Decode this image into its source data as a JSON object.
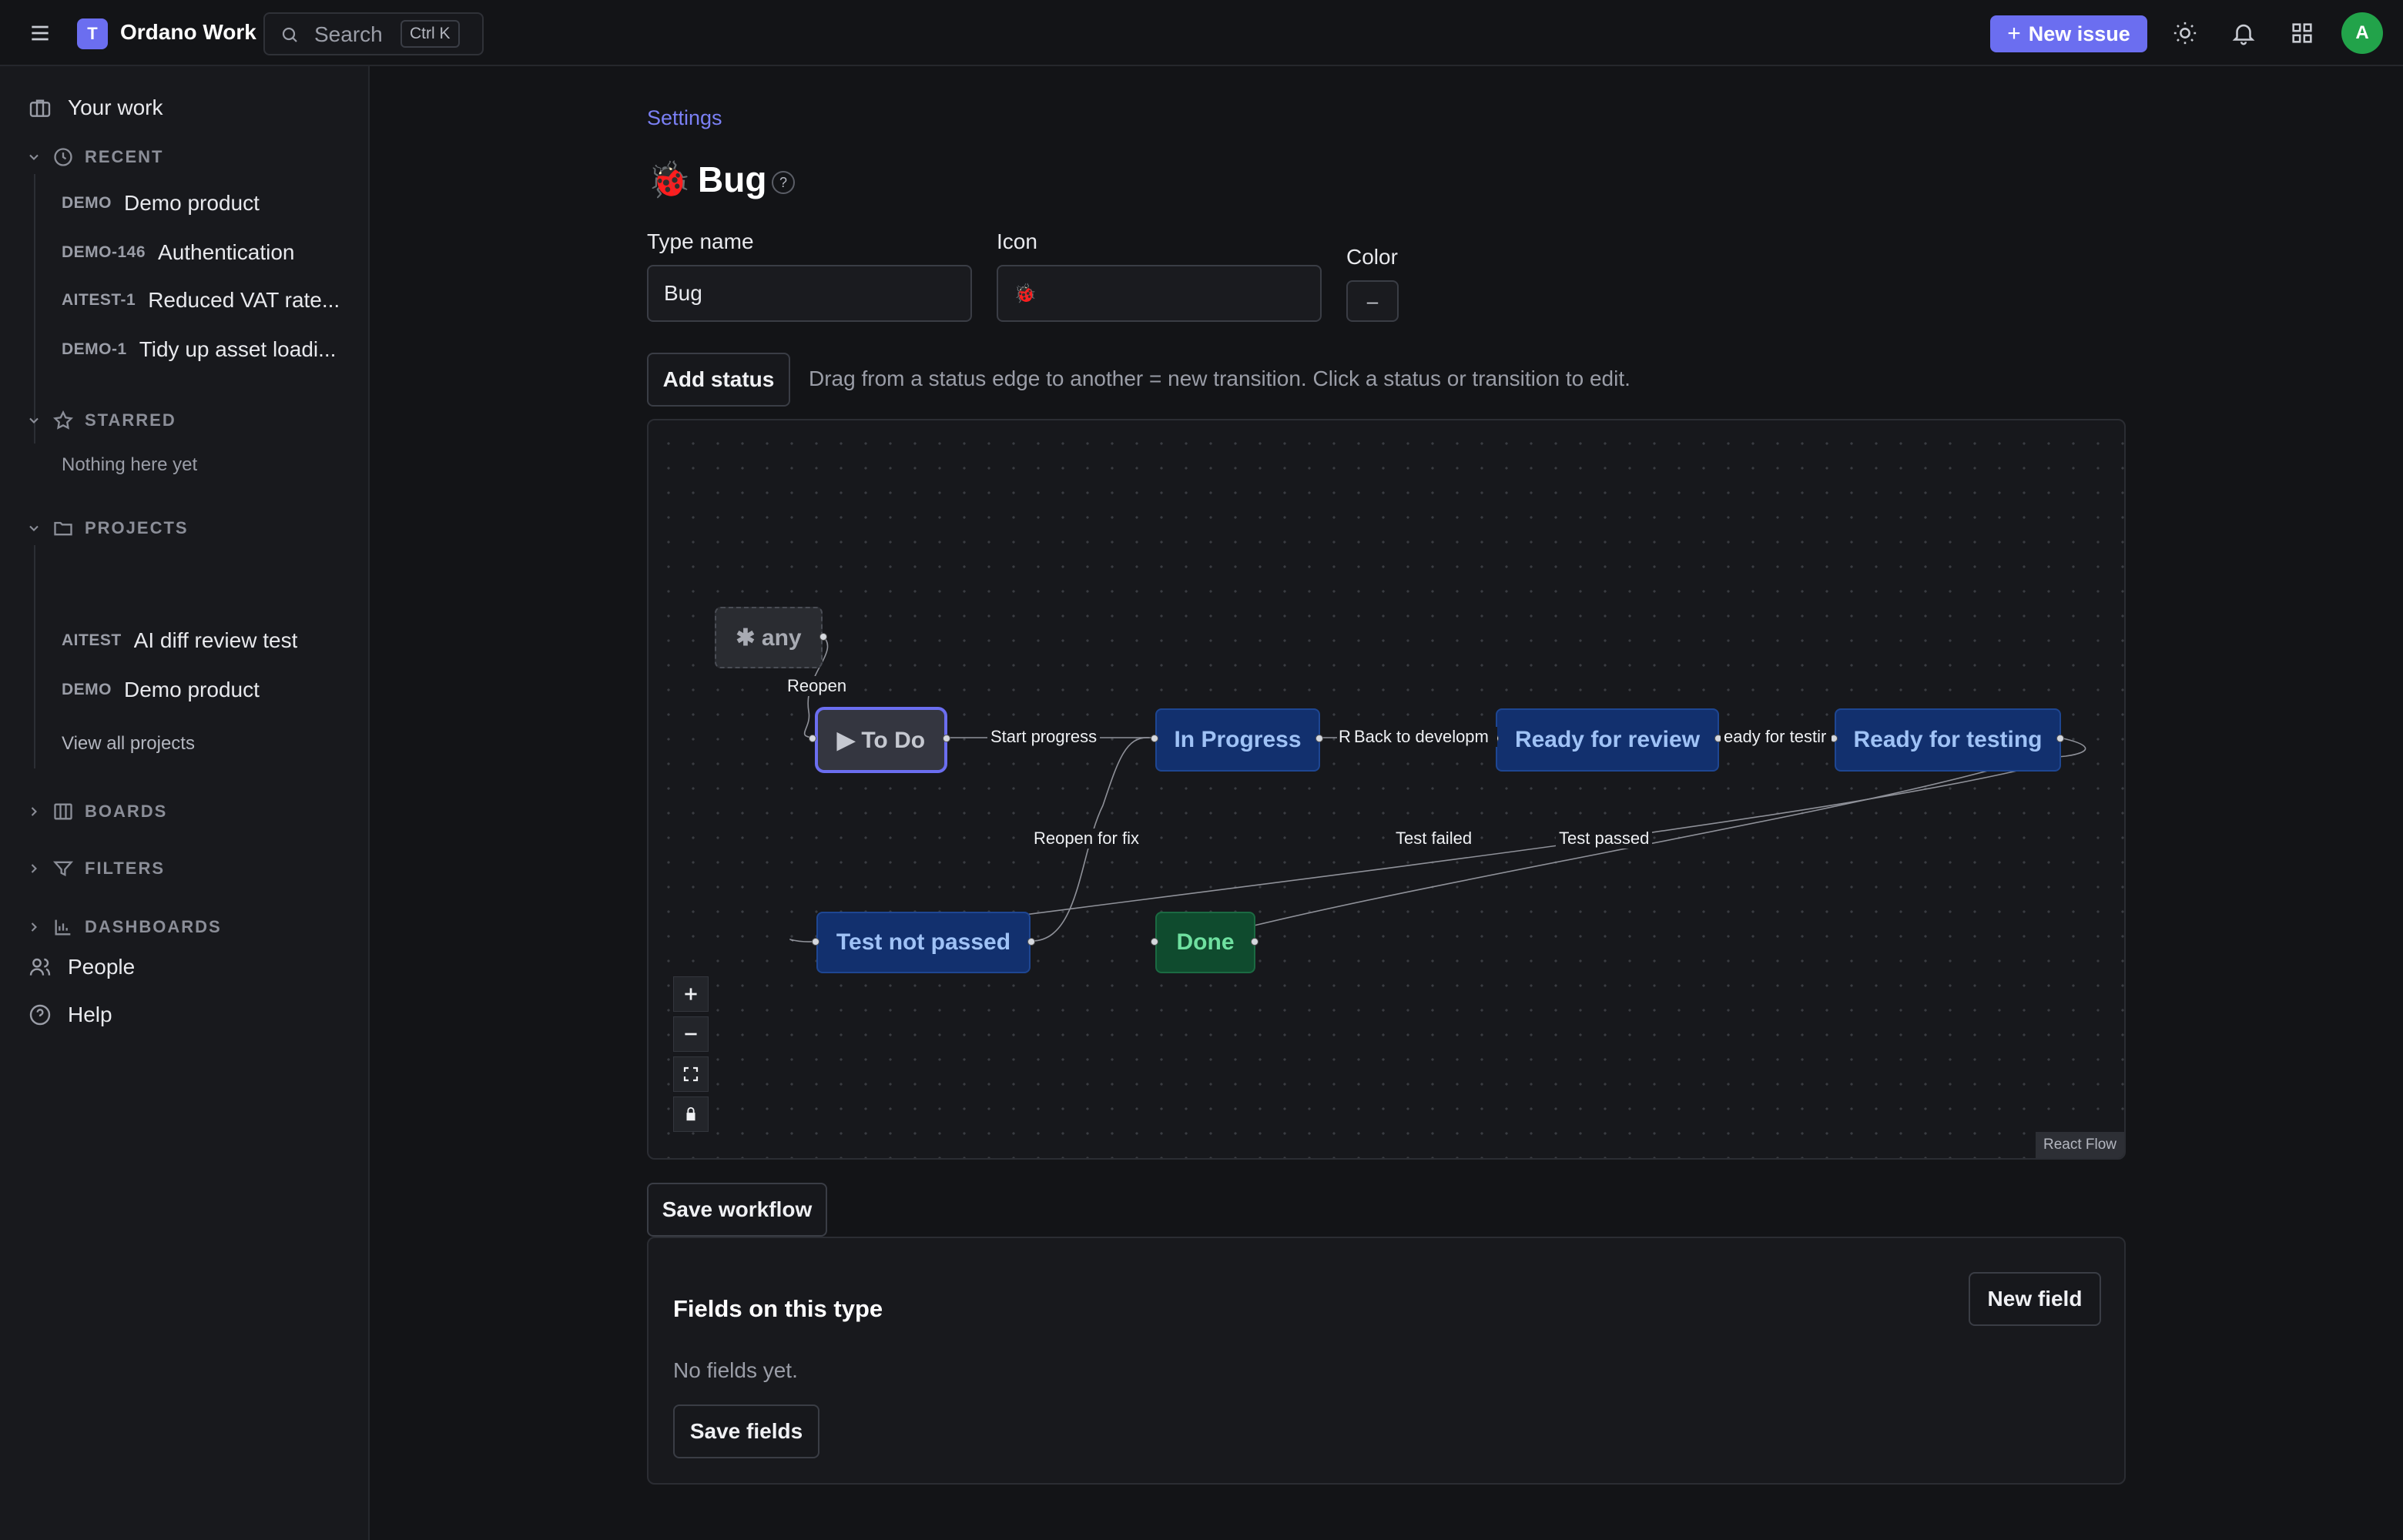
{
  "topbar": {
    "app_name": "Ordano Work",
    "logo_letter": "T",
    "search_placeholder": "Search",
    "search_shortcut": "Ctrl K",
    "new_issue_label": "New issue",
    "avatar_letter": "A",
    "accent_color": "#6b6ef0"
  },
  "sidebar": {
    "your_work": "Your work",
    "recent_heading": "RECENT",
    "recent_items": [
      {
        "key": "DEMO",
        "label": "Demo product"
      },
      {
        "key": "DEMO-146",
        "label": "Authentication"
      },
      {
        "key": "AITEST-1",
        "label": "Reduced VAT rate..."
      },
      {
        "key": "DEMO-1",
        "label": "Tidy up asset loadi..."
      }
    ],
    "starred_heading": "STARRED",
    "starred_empty": "Nothing here yet",
    "projects_heading": "PROJECTS",
    "projects": [
      {
        "key": "AITEST",
        "label": "AI diff review test"
      },
      {
        "key": "DEMO",
        "label": "Demo product"
      }
    ],
    "view_all_projects": "View all projects",
    "boards_heading": "BOARDS",
    "filters_heading": "FILTERS",
    "dashboards_heading": "DASHBOARDS",
    "people": "People",
    "help": "Help"
  },
  "main": {
    "breadcrumb": "Settings",
    "type_icon": "🐞",
    "title": "Bug",
    "help_badge": "?",
    "type_name_label": "Type name",
    "type_name_value": "Bug",
    "icon_label": "Icon",
    "icon_value": "🐞",
    "color_label": "Color",
    "color_swatch": "–",
    "add_status_label": "Add status",
    "hint": "Drag from a status edge to another = new transition. Click a status or transition to edit.",
    "save_workflow_label": "Save workflow"
  },
  "workflow": {
    "nodes": {
      "any": "✱ any",
      "todo": "▶ To Do",
      "in_progress": "In Progress",
      "ready_review": "Ready for review",
      "ready_testing": "Ready for testing",
      "test_not_passed": "Test not passed",
      "done": "Done"
    },
    "edges": {
      "reopen": "Reopen",
      "start_progress": "Start progress",
      "back_to_dev": "Back to developm",
      "r_fragment": "R",
      "ready_for_testing_frag": "eady for testir",
      "reopen_for_fix": "Reopen for fix",
      "test_failed": "Test failed",
      "test_passed": "Test passed"
    },
    "attribution": "React Flow"
  },
  "fields": {
    "heading": "Fields on this type",
    "new_field_label": "New field",
    "empty": "No fields yet.",
    "save_fields_label": "Save fields"
  }
}
